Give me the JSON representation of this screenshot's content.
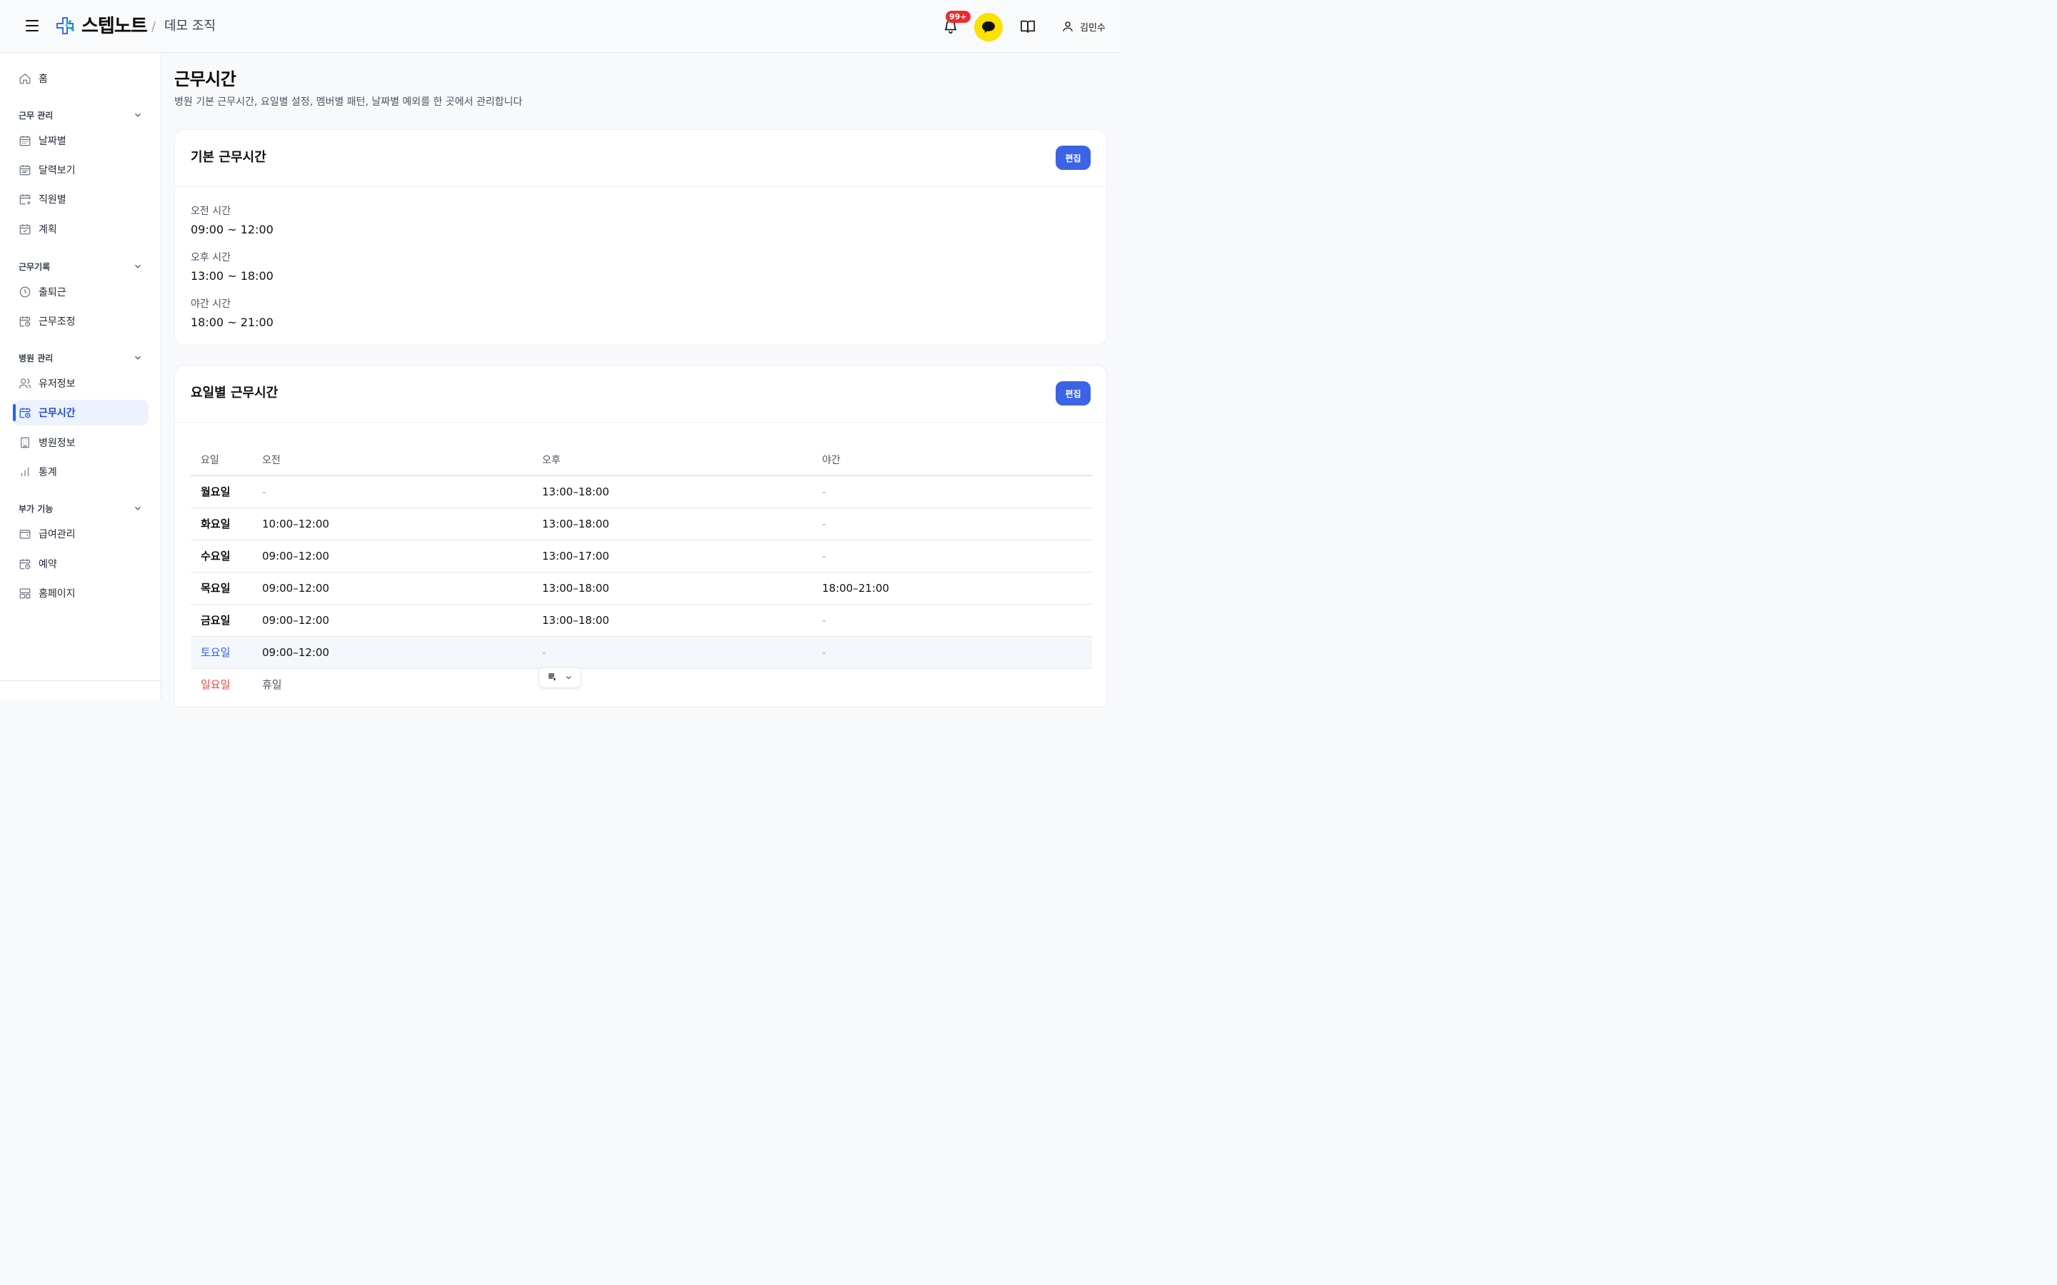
{
  "header": {
    "brand": "스텝노트",
    "separator": "/",
    "org": "데모 조직",
    "notification_badge": "99+",
    "user_name": "김민수"
  },
  "sidebar": {
    "home": "홈",
    "sections": [
      {
        "label": "근무 관리",
        "items": [
          "날짜별",
          "달력보기",
          "직원별",
          "계획"
        ]
      },
      {
        "label": "근무기록",
        "items": [
          "출퇴근",
          "근무조정"
        ]
      },
      {
        "label": "병원 관리",
        "items": [
          "유저정보",
          "근무시간",
          "병원정보",
          "통계"
        ]
      },
      {
        "label": "부가 기능",
        "items": [
          "급여관리",
          "예약",
          "홈페이지"
        ]
      }
    ],
    "active_item": "근무시간"
  },
  "page": {
    "title": "근무시간",
    "subtitle": "병원 기본 근무시간, 요일별 설정, 멤버별 패턴, 날짜별 예외를 한 곳에서 관리합니다"
  },
  "basic_hours": {
    "title": "기본 근무시간",
    "edit_label": "편집",
    "fields": [
      {
        "label": "오전 시간",
        "value": "09:00 ~ 12:00"
      },
      {
        "label": "오후 시간",
        "value": "13:00 ~ 18:00"
      },
      {
        "label": "야간 시간",
        "value": "18:00 ~ 21:00"
      }
    ]
  },
  "weekday_hours": {
    "title": "요일별 근무시간",
    "edit_label": "편집",
    "columns": [
      "요일",
      "오전",
      "오후",
      "야간"
    ],
    "rows": [
      [
        "월요일",
        "-",
        "13:00–18:00",
        "-"
      ],
      [
        "화요일",
        "10:00–12:00",
        "13:00–18:00",
        "-"
      ],
      [
        "수요일",
        "09:00–12:00",
        "13:00–17:00",
        "-"
      ],
      [
        "목요일",
        "09:00–12:00",
        "13:00–18:00",
        "18:00–21:00"
      ],
      [
        "금요일",
        "09:00–12:00",
        "13:00–18:00",
        "-"
      ],
      [
        "토요일",
        "09:00–12:00",
        "-",
        "-"
      ],
      [
        "일요일",
        "휴일",
        "",
        ""
      ]
    ]
  },
  "colors": {
    "accent": "#3b63e6",
    "saturday": "#2563eb",
    "sunday": "#ef4444",
    "kakao": "#fae100",
    "badge": "#ef2b2d"
  }
}
